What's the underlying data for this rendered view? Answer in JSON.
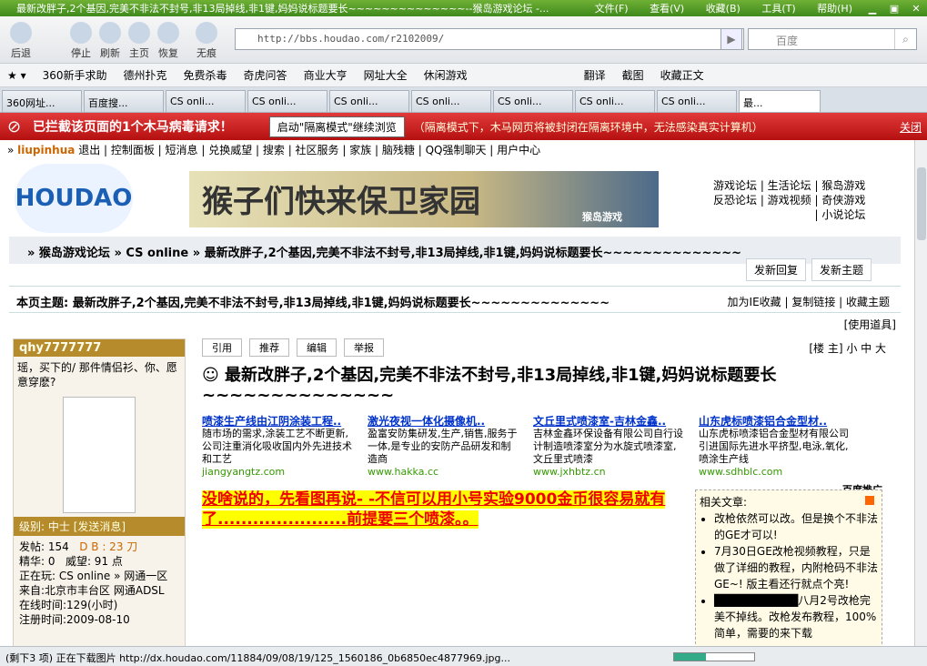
{
  "window": {
    "title": "最新改胖子,2个基因,完美不非法不封号,非13局掉线,非1键,妈妈说标题要长~~~~~~~~~~~~~~--猴岛游戏论坛 -...",
    "menu": [
      "文件(F)",
      "查看(V)",
      "收藏(B)",
      "工具(T)",
      "帮助(H)"
    ]
  },
  "nav": {
    "back": "后退",
    "stop": "停止",
    "refresh": "刷新",
    "home": "主页",
    "restore": "恢复",
    "noTrace": "无痕",
    "url": "http://bbs.houdao.com/r2102009/",
    "searchPlaceholder": "百度"
  },
  "favorites": [
    "360新手求助",
    "德州扑克",
    "免费杀毒",
    "奇虎问答",
    "商业大亨",
    "网址大全",
    "休闲游戏",
    "翻译",
    "截图",
    "收藏正文"
  ],
  "tabs": [
    "360网址...",
    "百度搜...",
    "CS onli...",
    "CS onli...",
    "CS onli...",
    "CS onli...",
    "CS onli...",
    "CS onli...",
    "CS onli...",
    "最..."
  ],
  "alert": {
    "message": "已拦截该页面的1个木马病毒请求！",
    "button": "启动\"隔离模式\"继续浏览",
    "note": "（隔离模式下，木马网页将被封闭在隔离环境中，无法感染真实计算机）",
    "close": "关闭"
  },
  "forum": {
    "userbar": {
      "user": "liupinhua",
      "links": "退出 | 控制面板 | 短消息 | 兑换威望 | 搜索 | 社区服务 | 家族 | 脑残糖 | QQ强制聊天 | 用户中心"
    },
    "logo": "HOUDAO",
    "banner": {
      "text": "猴子们快来保卫家园",
      "sub": "猴岛游戏"
    },
    "toplinks": [
      "游戏论坛 | 生活论坛 | 猴岛游戏",
      "反恐论坛 | 游戏视频 | 奇侠游戏",
      "| 小说论坛"
    ],
    "breadcrumb": "» 猴岛游戏论坛 » CS online » 最新改胖子,2个基因,完美不非法不封号,非13局掉线,非1键,妈妈说标题要长~~~~~~~~~~~~~~",
    "reply": "发新回复",
    "newTopic": "发新主题",
    "topic": "本页主题: 最新改胖子,2个基因,完美不非法不封号,非13局掉线,非1键,妈妈说标题要长~~~~~~~~~~~~~~",
    "topicLinks": "加为IE收藏 | 复制链接 | 收藏主题",
    "tools": "[使用道具]"
  },
  "profile": {
    "name": "qhy7777777",
    "sig": "瑶，买下的/ 那件情侣衫、你、愿意穿麽?",
    "level": "级别: 中士",
    "sendMsg": "[发送消息]",
    "stats": {
      "posts": "发帖: 154",
      "db": "D B : 23 刀",
      "essence": "精华: 0",
      "prestige": "威望: 91 点",
      "playing": "正在玩: CS online » 网通一区",
      "from": "来自:北京市丰台区 网通ADSL",
      "online": "在线时间:129(小时)",
      "reg": "注册时间:2009-08-10"
    }
  },
  "post": {
    "buttons": [
      "引用",
      "推荐",
      "编辑",
      "举报"
    ],
    "size": "[楼 主] 小 中 大",
    "title": "最新改胖子,2个基因,完美不非法不封号,非13局掉线,非1键,妈妈说标题要长~~~~~~~~~~~~~~",
    "ads": [
      {
        "h": "喷漆生产线由江阴涂装工程..",
        "t": "随市场的需求,涂装工艺不断更新,公司注重消化吸收国内外先进技术和工艺",
        "u": "jiangyangtz.com"
      },
      {
        "h": "激光夜视一体化摄像机..",
        "t": "盈富安防集研发,生产,销售,服务于一体,是专业的安防产品研发和制造商",
        "u": "www.hakka.cc"
      },
      {
        "h": "文丘里式喷漆室-吉林金鑫..",
        "t": "吉林金鑫环保设备有限公司自行设计制造喷漆室分为水旋式喷漆室,文丘里式喷漆",
        "u": "www.jxhbtz.cn"
      },
      {
        "h": "山东虎标喷漆铝合金型材..",
        "t": "山东虎标喷漆铝合金型材有限公司引进国际先进水平挤型,电泳,氧化,喷涂生产线",
        "u": "www.sdhblc.com"
      }
    ],
    "baidu": "百度推广",
    "body": "没啥说的，先看图再说- -不信可以用小号实验9000金币很容易就有了......................前提要三个喷漆。。"
  },
  "related": {
    "title": "相关文章:",
    "items": [
      "改枪依然可以改。但是换个不非法的GE才可以!",
      "7月30日GE改枪视频教程，只是做了详细的教程，内附枪码不非法GE~! 版主看还行就点个亮!",
      "八月2号改枪完美不掉线。改枪发布教程，100%简单，需要的来下载"
    ]
  },
  "status": {
    "text": "(剩下3 项) 正在下载图片 http://dx.houdao.com/11884/09/08/19/125_1560186_0b6850ec4877969.jpg...",
    "progress": 0.4
  }
}
